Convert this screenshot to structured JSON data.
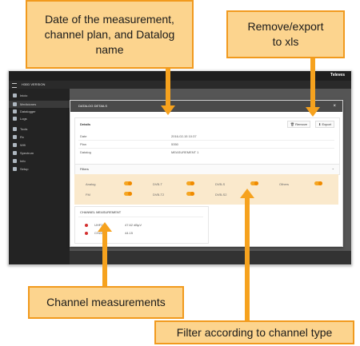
{
  "callouts": {
    "date": "Date of the measurement, channel plan, and Datalog name",
    "remove": "Remove/export to xls",
    "channel": "Channel measurements",
    "filter": "Filter according to channel type"
  },
  "app": {
    "brand": "Televes",
    "title": "H30D  VERSION"
  },
  "sidebar": {
    "items": [
      "Inicio",
      "Mediciones",
      "Datalogger",
      "Logs",
      "Tools",
      "Rx",
      "Wifi",
      "Spectrum",
      "Info",
      "Setup"
    ]
  },
  "modal": {
    "title": "DATALOG DETAILS",
    "details_heading": "Details",
    "remove_label": "Remove",
    "export_label": "Export",
    "rows": [
      {
        "label": "Date",
        "value": "2016-02-15 10:37"
      },
      {
        "label": "Plan",
        "value": "5350"
      },
      {
        "label": "Datalog",
        "value": "MEASUREMENT 1"
      }
    ],
    "filter_heading": "Filters",
    "filters": [
      "Analog",
      "DVB-T",
      "DVB-S",
      "Others",
      "FM",
      "DVB-T2",
      "DVB-S2"
    ],
    "measure_heading": "CHANNEL MEASUREMENT",
    "measurements": [
      {
        "ch": "UHF21",
        "val": "47.62 dBµV"
      },
      {
        "ch": "CH22",
        "val": "44.15"
      }
    ]
  },
  "colors": {
    "callout_fill": "#fcd48e",
    "callout_border": "#f19a1e",
    "arrow": "#f6a21e",
    "toggle": "#f5a623",
    "measurement_dot": "#d32f2f"
  }
}
